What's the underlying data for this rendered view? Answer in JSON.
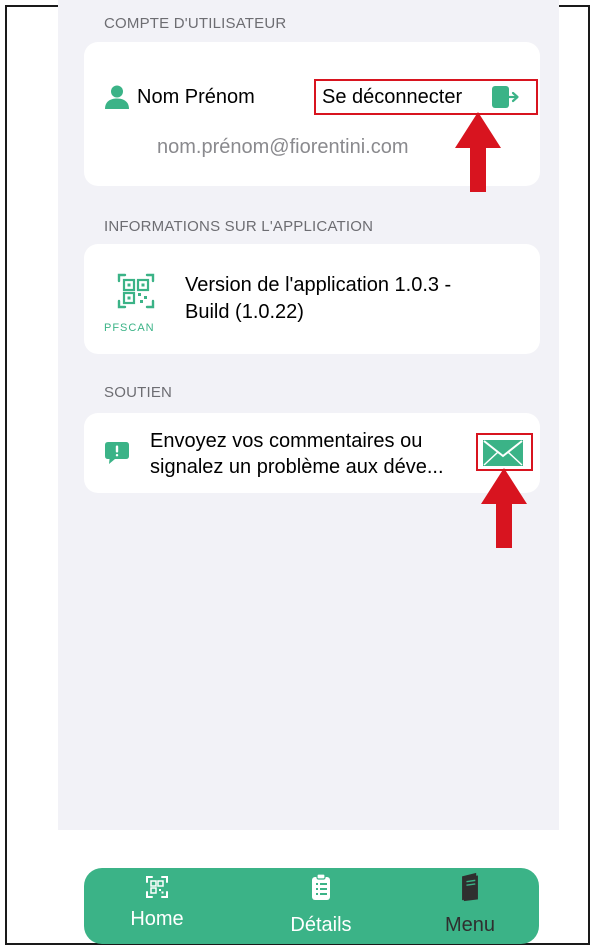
{
  "sections": {
    "account_header": "COMPTE D'UTILISATEUR",
    "app_info_header": "INFORMATIONS SUR L'APPLICATION",
    "support_header": "SOUTIEN"
  },
  "account": {
    "name": "Nom Prénom",
    "logout_label": "Se déconnecter",
    "email": "nom.prénom@fiorentini.com"
  },
  "app_info": {
    "logo_text": "PFSCAN",
    "version_line1": "Version de l'application 1.0.3 -",
    "version_line2": "Build (1.0.22)"
  },
  "support": {
    "line1": "Envoyez vos commentaires ou",
    "line2": "signalez un problème aux déve..."
  },
  "tabbar": {
    "home": "Home",
    "details": "Détails",
    "menu": "Menu"
  },
  "colors": {
    "accent": "#3bb387",
    "highlight": "#d8141f",
    "background": "#f2f2f7"
  }
}
